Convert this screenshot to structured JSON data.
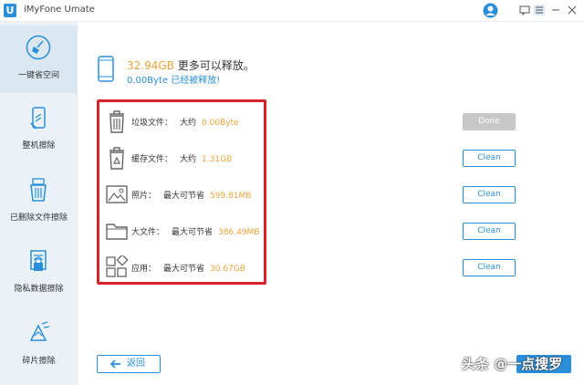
{
  "app": {
    "title": "iMyFone Umate",
    "logo_letter": "U"
  },
  "sidebar": {
    "items": [
      {
        "label": "一键省空间",
        "active": true
      },
      {
        "label": "整机擦除"
      },
      {
        "label": "已删除文件擦除"
      },
      {
        "label": "隐私数据擦除"
      },
      {
        "label": "碎片擦除"
      }
    ]
  },
  "summary": {
    "amount": "32.94GB",
    "amount_suffix": " 更多可以释放。",
    "freed_line": "0.00Byte 已经被释放!"
  },
  "rows": [
    {
      "label": "垃圾文件：",
      "pre": "大约",
      "size": "0.00Byte",
      "button": "Done",
      "button_disabled": true
    },
    {
      "label": "缓存文件：",
      "pre": "大约",
      "size": "1.31GB",
      "button": "Clean"
    },
    {
      "label": "照片：",
      "pre": "最大可节省",
      "size": "599.81MB",
      "button": "Clean"
    },
    {
      "label": "大文件：",
      "pre": "最大可节省",
      "size": "386.49MB",
      "button": "Clean"
    },
    {
      "label": "应用：",
      "pre": "最大可节省",
      "size": "30.67GB",
      "button": "Clean"
    }
  ],
  "footer": {
    "back_label": "返回"
  },
  "watermark": "头条 @一点搜罗",
  "colors": {
    "accent": "#2a8fd8",
    "highlight": "#e8a33b",
    "annotation_box": "#d6252a"
  }
}
